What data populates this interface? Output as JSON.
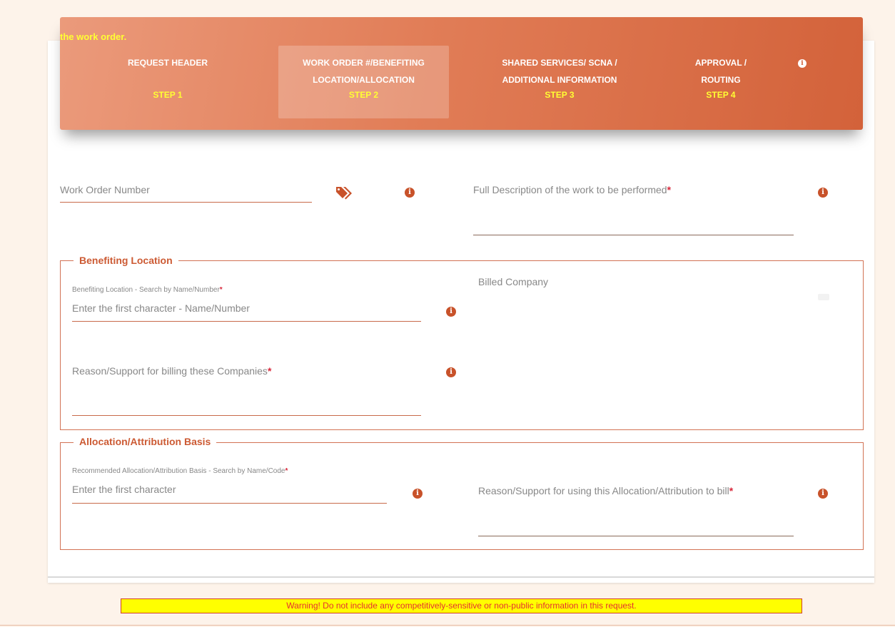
{
  "stepper": {
    "intro_text": "the work order.",
    "steps": [
      {
        "label_line1": "REQUEST HEADER",
        "label_line2": "",
        "step": "STEP 1"
      },
      {
        "label_line1": "WORK ORDER #/BENEFITING",
        "label_line2": "LOCATION/ALLOCATION",
        "step": "STEP 2"
      },
      {
        "label_line1": "SHARED SERVICES/ SCNA /",
        "label_line2": "ADDITIONAL INFORMATION",
        "step": "STEP 3"
      },
      {
        "label_line1": "APPROVAL /",
        "label_line2": "ROUTING",
        "step": "STEP 4"
      }
    ],
    "active_step": 2,
    "info_icon": "info-circle-icon"
  },
  "work_order": {
    "number_label": "Work Order Number",
    "tag_icon": "tags-icon",
    "description_label": "Full Description of the work to be performed",
    "required_marker": "*"
  },
  "benefiting_location": {
    "legend": "Benefiting Location",
    "search_label": "Benefiting Location - Search by Name/Number",
    "search_placeholder": "Enter the first character - Name/Number",
    "billed_company_label": "Billed Company",
    "reason_label": "Reason/Support for billing these Companies",
    "required_marker": "*"
  },
  "allocation": {
    "legend": "Allocation/Attribution Basis",
    "search_label": "Recommended Allocation/Attribution Basis - Search by Name/Code",
    "search_placeholder": "Enter the first character",
    "reason_label": "Reason/Support for using this Allocation/Attribution to bill",
    "required_marker": "*"
  },
  "warning": {
    "text": "Warning! Do not include any competitively-sensitive or non-public information in this request."
  },
  "colors": {
    "accent": "#d3623a",
    "step_number": "#ffff33",
    "required": "#d8283b",
    "warning_bg": "#ffff00"
  }
}
